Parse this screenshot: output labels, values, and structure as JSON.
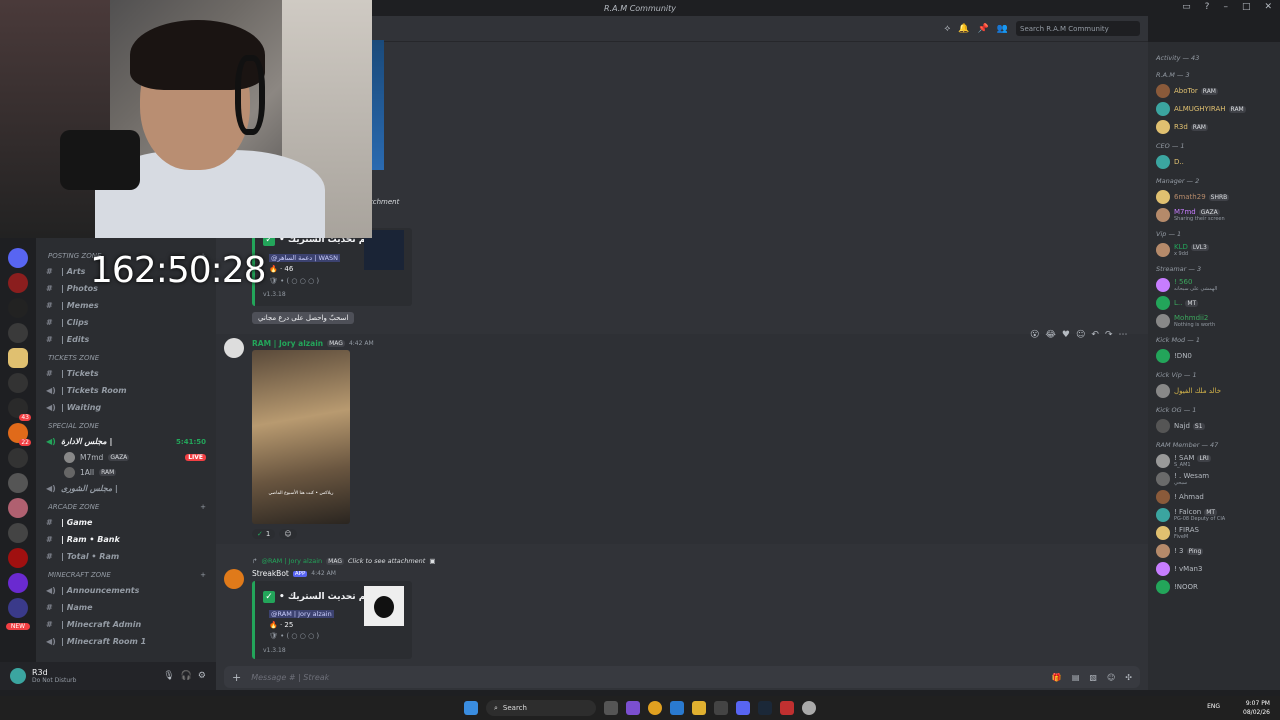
{
  "window": {
    "title": "R.A.M Community"
  },
  "webcam": {
    "timer": "162:50:28"
  },
  "server_rail": {
    "badges": [
      "43",
      "22",
      "NEW"
    ]
  },
  "channels": {
    "categories": [
      {
        "label": "POSTING ZONE",
        "items": [
          "| Arts",
          "| Photos",
          "| Memes",
          "| Clips",
          "| Edits"
        ]
      },
      {
        "label": "TICKETS ZONE",
        "items": [
          "| Tickets",
          "| Tickets Room",
          "| Waiting"
        ]
      },
      {
        "label": "SPECIAL ZONE",
        "voice": "مجلس الادارة |",
        "voice_time": "5:41:50",
        "users": [
          {
            "name": "M7md",
            "tag": "GAZA",
            "live": "LIVE"
          },
          {
            "name": "1All",
            "tag": "RAM"
          }
        ],
        "extra": "مجلس الشورى |"
      },
      {
        "label": "ARCADE ZONE",
        "items": [
          "| Game",
          "| Ram • Bank",
          "| Total • Ram"
        ]
      },
      {
        "label": "MINECRAFT ZONE",
        "items": [
          "| Announcements",
          "| Name",
          "| Minecraft Admin",
          "| Minecraft Room 1"
        ]
      }
    ]
  },
  "user_panel": {
    "name": "R3d",
    "status": "Do Not Disturb"
  },
  "header": {
    "search_placeholder": "Search R.A.M Community"
  },
  "messages": {
    "m0": {
      "attachment_text": "tchment",
      "title": "• تم تحديث الستريك",
      "user": "@دعمة الساهر | WASN",
      "streak": "46",
      "version": "v1.3.18",
      "button": "اسحبّ واحصل على درع مجاني"
    },
    "m1": {
      "author": "RAM | Jory alzain",
      "tag": "MAG",
      "time": "4:42 AM",
      "caption": "ريلاكس • كنت هنا الأسبوع الماضي",
      "reaction_count": "1"
    },
    "m2": {
      "reply_user": "@RAM | Jory alzain",
      "reply_tag": "MAG",
      "reply_text": "Click to see attachment",
      "author": "StreakBot",
      "app_tag": "APP",
      "time": "4:42 AM",
      "title": "• تم تحديث الستريك",
      "user": "@RAM | Jory alzain",
      "streak": "25",
      "version": "v1.3.18"
    }
  },
  "input": {
    "placeholder": "Message # | Streak"
  },
  "members": {
    "groups": [
      {
        "label": "Activity — 43",
        "members": []
      },
      {
        "label": "R.A.M — 3",
        "members": [
          {
            "name": "AboTor",
            "tag": "RAM",
            "color": "#e0c070"
          },
          {
            "name": "ALMUGHYIRAH",
            "tag": "RAM",
            "color": "#e0c070"
          },
          {
            "name": "R3d",
            "tag": "RAM",
            "color": "#e0c070"
          }
        ]
      },
      {
        "label": "CEO — 1",
        "members": [
          {
            "name": "D..",
            "tag": "",
            "color": "#e0c070"
          }
        ]
      },
      {
        "label": "Manager — 2",
        "members": [
          {
            "name": "6math29",
            "tag": "SHRB",
            "color": "#b58a6a"
          },
          {
            "name": "M7md",
            "tag": "GAZA",
            "color": "#c77dff",
            "sub": "Sharing their screen"
          }
        ]
      },
      {
        "label": "Vip — 1",
        "members": [
          {
            "name": "KLD",
            "tag": "LVL3",
            "color": "#23a55a",
            "sub": "x 9dd"
          }
        ]
      },
      {
        "label": "Streamar — 3",
        "members": [
          {
            "name": "! 560",
            "tag": "",
            "color": "#3ba55c",
            "sub": "الهمشي على سبحانه"
          },
          {
            "name": "L..",
            "tag": "MT",
            "color": "#3ba55c"
          },
          {
            "name": "Mohmdii2",
            "tag": "",
            "color": "#3ba55c",
            "sub": "Nothing is worth"
          }
        ]
      },
      {
        "label": "Kick Mod — 1",
        "members": [
          {
            "name": "!DN0",
            "tag": "",
            "color": "#b5bac1"
          }
        ]
      },
      {
        "label": "Kick Vip — 1",
        "members": [
          {
            "name": "خالد ملك الفيول",
            "tag": "",
            "color": "#d4b44a"
          }
        ]
      },
      {
        "label": "Kick OG — 1",
        "members": [
          {
            "name": "Najd",
            "tag": "S1",
            "color": "#b5bac1"
          }
        ]
      },
      {
        "label": "RAM Member — 47",
        "members": [
          {
            "name": "! SAM",
            "tag": "LRI",
            "color": "#b5bac1",
            "sub": "S_AM1"
          },
          {
            "name": "! . Wesam",
            "tag": "",
            "color": "#b5bac1",
            "sub": "سبحي"
          },
          {
            "name": "! Ahmad",
            "tag": "",
            "color": "#b5bac1"
          },
          {
            "name": "! Falcon",
            "tag": "MT",
            "color": "#b5bac1",
            "sub": "PG-08 Deputy of CIA"
          },
          {
            "name": "! FIRAS",
            "tag": "",
            "color": "#b5bac1",
            "sub": "FiveM"
          },
          {
            "name": "! 3",
            "tag": "Ping",
            "color": "#b5bac1"
          },
          {
            "name": "! vMan3",
            "tag": "",
            "color": "#b5bac1"
          },
          {
            "name": "!NOOR",
            "tag": "",
            "color": "#b5bac1"
          }
        ]
      }
    ]
  },
  "taskbar": {
    "search": "Search",
    "lang": "ENG",
    "time": "9:07 PM",
    "date": "08/02/26"
  }
}
